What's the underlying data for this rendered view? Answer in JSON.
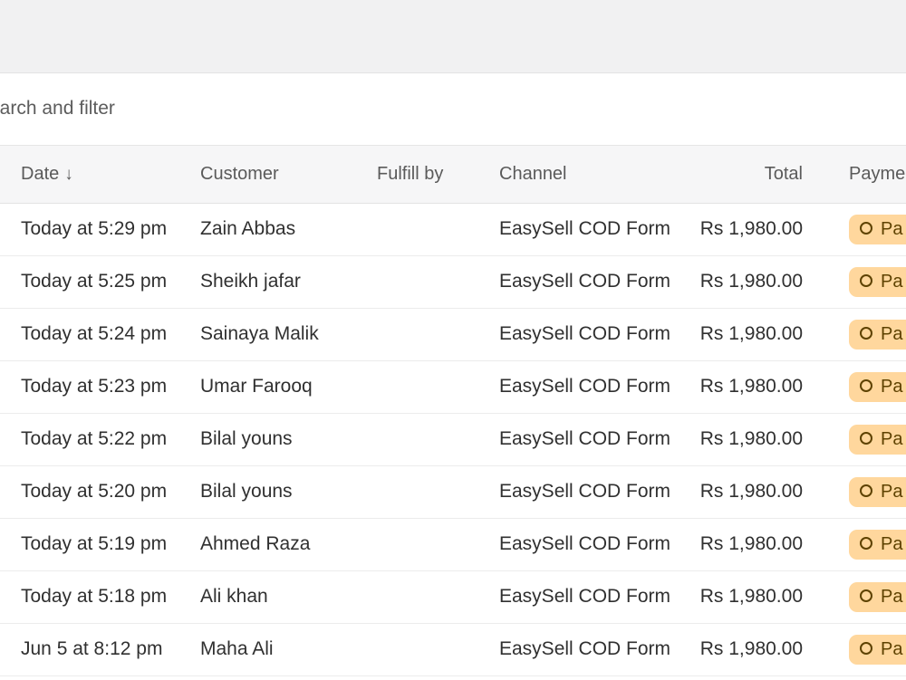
{
  "search": {
    "text": "earch and filter"
  },
  "table": {
    "columns": {
      "date": "Date",
      "date_sort_arrow": "↓",
      "customer": "Customer",
      "fulfill_by": "Fulfill by",
      "channel": "Channel",
      "total": "Total",
      "payment": "Payme"
    },
    "rows": [
      {
        "date": "Today at 5:29 pm",
        "customer": "Zain Abbas",
        "fulfill_by": "",
        "channel": "EasySell COD Form",
        "total": "Rs 1,980.00",
        "payment": "Pa"
      },
      {
        "date": "Today at 5:25 pm",
        "customer": "Sheikh jafar",
        "fulfill_by": "",
        "channel": "EasySell COD Form",
        "total": "Rs 1,980.00",
        "payment": "Pa"
      },
      {
        "date": "Today at 5:24 pm",
        "customer": "Sainaya Malik",
        "fulfill_by": "",
        "channel": "EasySell COD Form",
        "total": "Rs 1,980.00",
        "payment": "Pa"
      },
      {
        "date": "Today at 5:23 pm",
        "customer": "Umar Farooq",
        "fulfill_by": "",
        "channel": "EasySell COD Form",
        "total": "Rs 1,980.00",
        "payment": "Pa"
      },
      {
        "date": "Today at 5:22 pm",
        "customer": "Bilal youns",
        "fulfill_by": "",
        "channel": "EasySell COD Form",
        "total": "Rs 1,980.00",
        "payment": "Pa"
      },
      {
        "date": "Today at 5:20 pm",
        "customer": "Bilal youns",
        "fulfill_by": "",
        "channel": "EasySell COD Form",
        "total": "Rs 1,980.00",
        "payment": "Pa"
      },
      {
        "date": "Today at 5:19 pm",
        "customer": "Ahmed Raza",
        "fulfill_by": "",
        "channel": "EasySell COD Form",
        "total": "Rs 1,980.00",
        "payment": "Pa"
      },
      {
        "date": "Today at 5:18 pm",
        "customer": "Ali khan",
        "fulfill_by": "",
        "channel": "EasySell COD Form",
        "total": "Rs 1,980.00",
        "payment": "Pa"
      },
      {
        "date": "Jun 5 at 8:12 pm",
        "customer": "Maha Ali",
        "fulfill_by": "",
        "channel": "EasySell COD Form",
        "total": "Rs 1,980.00",
        "payment": "Pa"
      }
    ]
  },
  "colors": {
    "payment_badge_bg": "#ffd79d",
    "payment_badge_text": "#5e4200"
  },
  "icons": {
    "payment_status": "pending-ring-icon",
    "sort": "arrow-down-icon"
  }
}
